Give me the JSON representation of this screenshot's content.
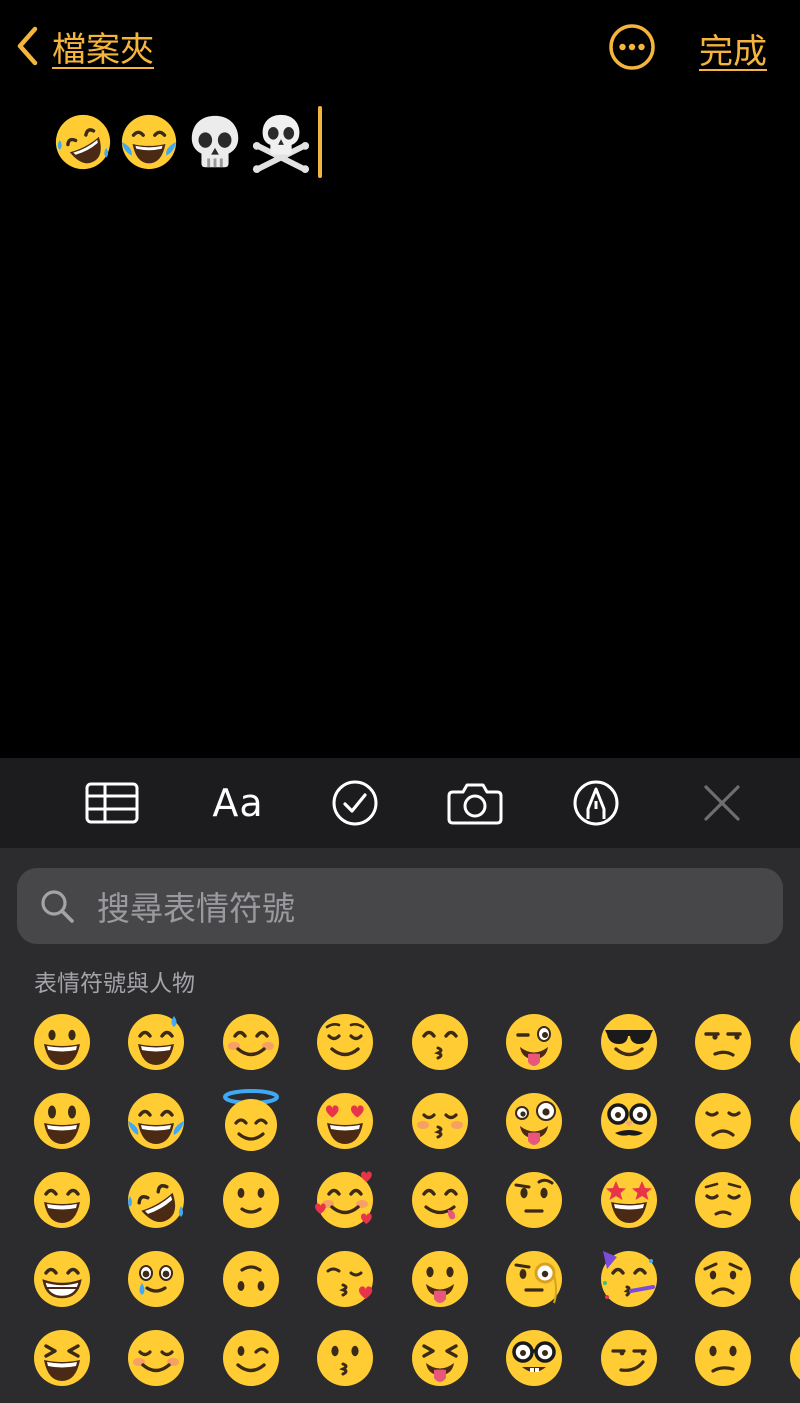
{
  "nav": {
    "back_label": "檔案夾",
    "done_label": "完成"
  },
  "toolbar": {
    "format_label": "Aa"
  },
  "keyboard": {
    "search_placeholder": "搜尋表情符號",
    "category_title": "表情符號與人物"
  },
  "colors": {
    "accent": "#F5B53D",
    "background": "#000000",
    "toolbar": "#1C1C1E",
    "keyboard": "#2C2C2E",
    "search_field": "#474749"
  },
  "note": {
    "emojis": [
      "rolling-on-floor-laughing",
      "face-with-tears-of-joy",
      "skull",
      "skull-and-crossbones"
    ]
  },
  "emoji_grid": [
    [
      "grinning",
      "grinning-sweat",
      "smiling-blush",
      "relieved",
      "kissing-smiling-eyes",
      "winking-tongue",
      "sunglasses",
      "unamused"
    ],
    [
      "smiley",
      "tears-of-joy",
      "halo",
      "heart-eyes",
      "kissing-closed-eyes",
      "zany",
      "disguised",
      "disappointed"
    ],
    [
      "grin",
      "rofl",
      "slight-smile",
      "smiling-hearts",
      "yum",
      "raised-eyebrow",
      "star-struck",
      "pensive"
    ],
    [
      "beaming",
      "holding-back-tears",
      "upside-down",
      "kissing-heart",
      "tongue-out",
      "monocle",
      "partying",
      "worried"
    ],
    [
      "laughing-squint",
      "blushing-smile",
      "wink",
      "kissing",
      "squint-tongue",
      "nerd",
      "smirk",
      "confused"
    ]
  ]
}
